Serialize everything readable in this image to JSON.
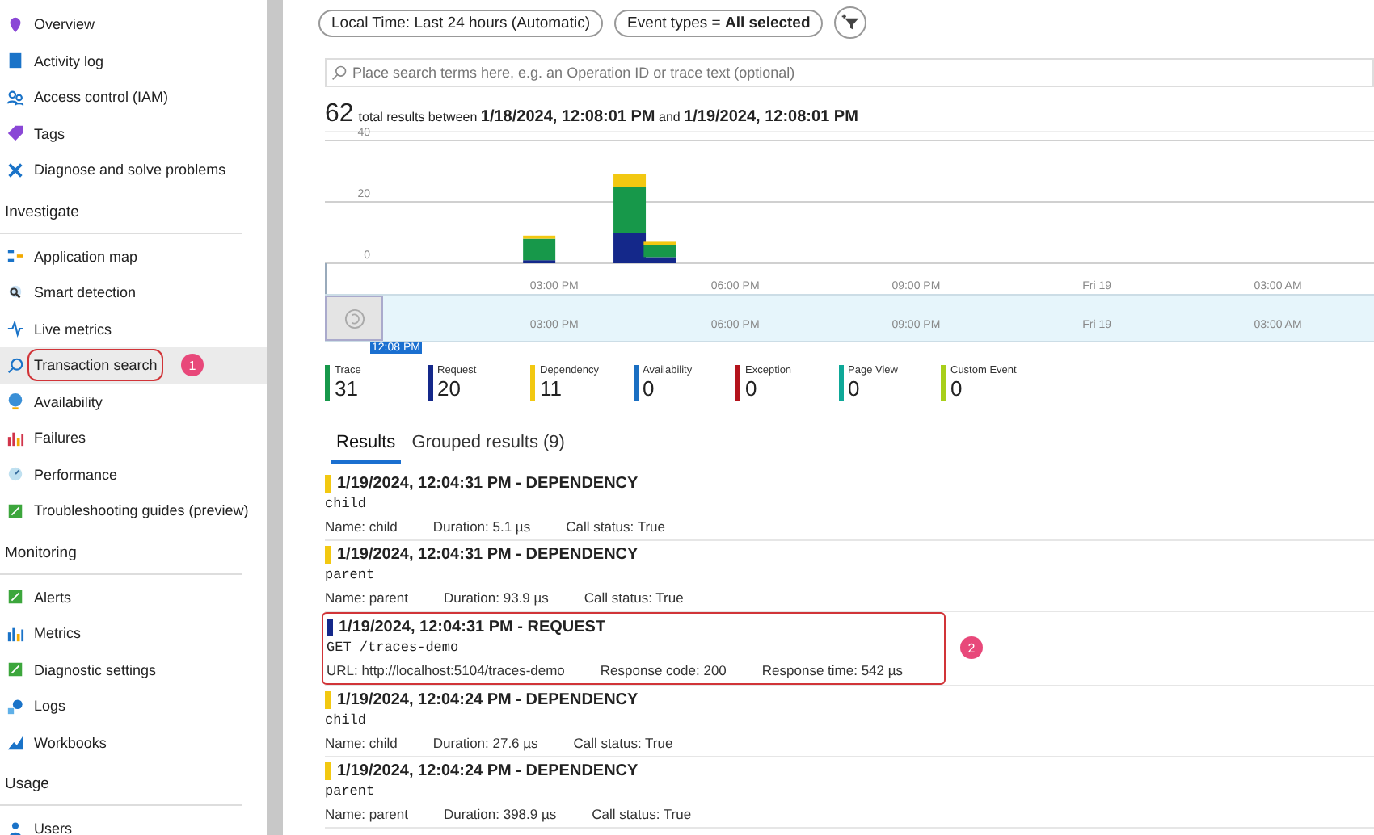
{
  "sidebar": {
    "sections": [
      {
        "items": [
          {
            "label": "Overview",
            "selected": false
          },
          {
            "label": "Activity log",
            "selected": false
          },
          {
            "label": "Access control (IAM)",
            "selected": false
          },
          {
            "label": "Tags",
            "selected": false
          },
          {
            "label": "Diagnose and solve problems",
            "selected": false
          }
        ]
      },
      {
        "title": "Investigate",
        "items": [
          {
            "label": "Application map",
            "selected": false
          },
          {
            "label": "Smart detection",
            "selected": false
          },
          {
            "label": "Live metrics",
            "selected": false
          },
          {
            "label": "Transaction search",
            "selected": true,
            "callout": "1"
          },
          {
            "label": "Availability",
            "selected": false
          },
          {
            "label": "Failures",
            "selected": false
          },
          {
            "label": "Performance",
            "selected": false
          },
          {
            "label": "Troubleshooting guides (preview)",
            "selected": false
          }
        ]
      },
      {
        "title": "Monitoring",
        "items": [
          {
            "label": "Alerts",
            "selected": false
          },
          {
            "label": "Metrics",
            "selected": false
          },
          {
            "label": "Diagnostic settings",
            "selected": false
          },
          {
            "label": "Logs",
            "selected": false
          },
          {
            "label": "Workbooks",
            "selected": false
          }
        ]
      },
      {
        "title": "Usage",
        "items": [
          {
            "label": "Users",
            "selected": false
          }
        ]
      }
    ]
  },
  "toolbar": {
    "time_filter": "Local Time: Last 24 hours (Automatic)",
    "event_filter": "Event types = **All selected**"
  },
  "search": {
    "placeholder": "Place search terms here, e.g. an Operation ID or trace text (optional)"
  },
  "summary": {
    "count": "62",
    "text": "total results between **1/18/2024, 12:08:01 PM** and **1/19/2024, 12:08:01 PM**"
  },
  "chart_data": {
    "type": "bar",
    "stacked": true,
    "ylim": [
      0,
      40
    ],
    "yticks": [
      0,
      20,
      40
    ],
    "categories": [
      null,
      null,
      null,
      null,
      null,
      null,
      "03:00 PM",
      null,
      null,
      null,
      null,
      null,
      "06:00 PM",
      null,
      null,
      null,
      null,
      null,
      "09:00 PM",
      null,
      null,
      null,
      null,
      null,
      "Fri 19",
      null,
      null,
      null,
      null,
      null,
      "03:00 AM",
      null,
      null,
      null
    ],
    "series": [
      {
        "name": "Request",
        "color": "#14288a",
        "values": [
          null,
          null,
          null,
          null,
          null,
          1,
          null,
          null,
          10,
          2,
          null,
          null,
          null,
          null,
          null,
          null,
          null,
          null,
          null,
          null,
          null,
          null,
          null,
          null,
          null,
          null,
          null,
          null,
          null,
          null,
          null,
          null,
          null,
          null
        ]
      },
      {
        "name": "Trace",
        "color": "#17984a",
        "values": [
          null,
          null,
          null,
          null,
          null,
          7,
          null,
          null,
          15,
          4,
          null,
          null,
          null,
          null,
          null,
          null,
          null,
          null,
          null,
          null,
          null,
          null,
          null,
          null,
          null,
          null,
          null,
          null,
          null,
          null,
          null,
          null,
          null,
          null
        ]
      },
      {
        "name": "Dependency",
        "color": "#f2c811",
        "values": [
          null,
          null,
          null,
          null,
          null,
          1,
          null,
          null,
          4,
          1,
          null,
          null,
          null,
          null,
          null,
          null,
          null,
          null,
          null,
          null,
          null,
          null,
          null,
          null,
          null,
          null,
          null,
          null,
          null,
          null,
          null,
          null,
          null,
          null
        ]
      }
    ]
  },
  "timeline": {
    "ticks": [
      "03:00 PM",
      "06:00 PM",
      "09:00 PM",
      "Fri 19",
      "03:00 AM"
    ],
    "start_label": "12:08 PM"
  },
  "legend": [
    {
      "count": "31"
    },
    {
      "count": "20"
    },
    {
      "count": "11"
    },
    {
      "name": "Availability",
      "count": "0",
      "color": "#1a6fc2"
    },
    {
      "name": "Exception",
      "count": "0",
      "color": "#b4131c"
    },
    {
      "name": "Page View",
      "count": "0",
      "color": "#0ea898"
    },
    {
      "name": "Custom Event",
      "count": "0",
      "color": "#a8cf1a"
    }
  ],
  "tabs": [
    {
      "label": "Results",
      "selected": true
    },
    {
      "label": "Grouped results (9)",
      "selected": false
    }
  ],
  "results": [
    {
      "color": "#f2c811",
      "title": "1/19/2024, 12:04:31 PM - DEPENDENCY",
      "name": "child",
      "fields": [
        "Name: child",
        "Duration: 5.1 µs",
        "Call status: True"
      ]
    },
    {
      "color": "#f2c811",
      "title": "1/19/2024, 12:04:31 PM - DEPENDENCY",
      "name": "parent",
      "fields": [
        "Name: parent",
        "Duration: 93.9 µs",
        "Call status: True"
      ]
    },
    {
      "color": "#14288a",
      "title": "1/19/2024, 12:04:31 PM - REQUEST",
      "name": "GET /traces-demo",
      "fields": [
        "URL: http://localhost:5104/traces-demo",
        "Response code: 200",
        "Response time: 542 µs"
      ],
      "callout": "2"
    },
    {
      "color": "#f2c811",
      "title": "1/19/2024, 12:04:24 PM - DEPENDENCY",
      "name": "child",
      "fields": [
        "Name: child",
        "Duration: 27.6 µs",
        "Call status: True"
      ]
    },
    {
      "color": "#f2c811",
      "title": "1/19/2024, 12:04:24 PM - DEPENDENCY",
      "name": "parent",
      "fields": [
        "Name: parent",
        "Duration: 398.9 µs",
        "Call status: True"
      ]
    }
  ]
}
